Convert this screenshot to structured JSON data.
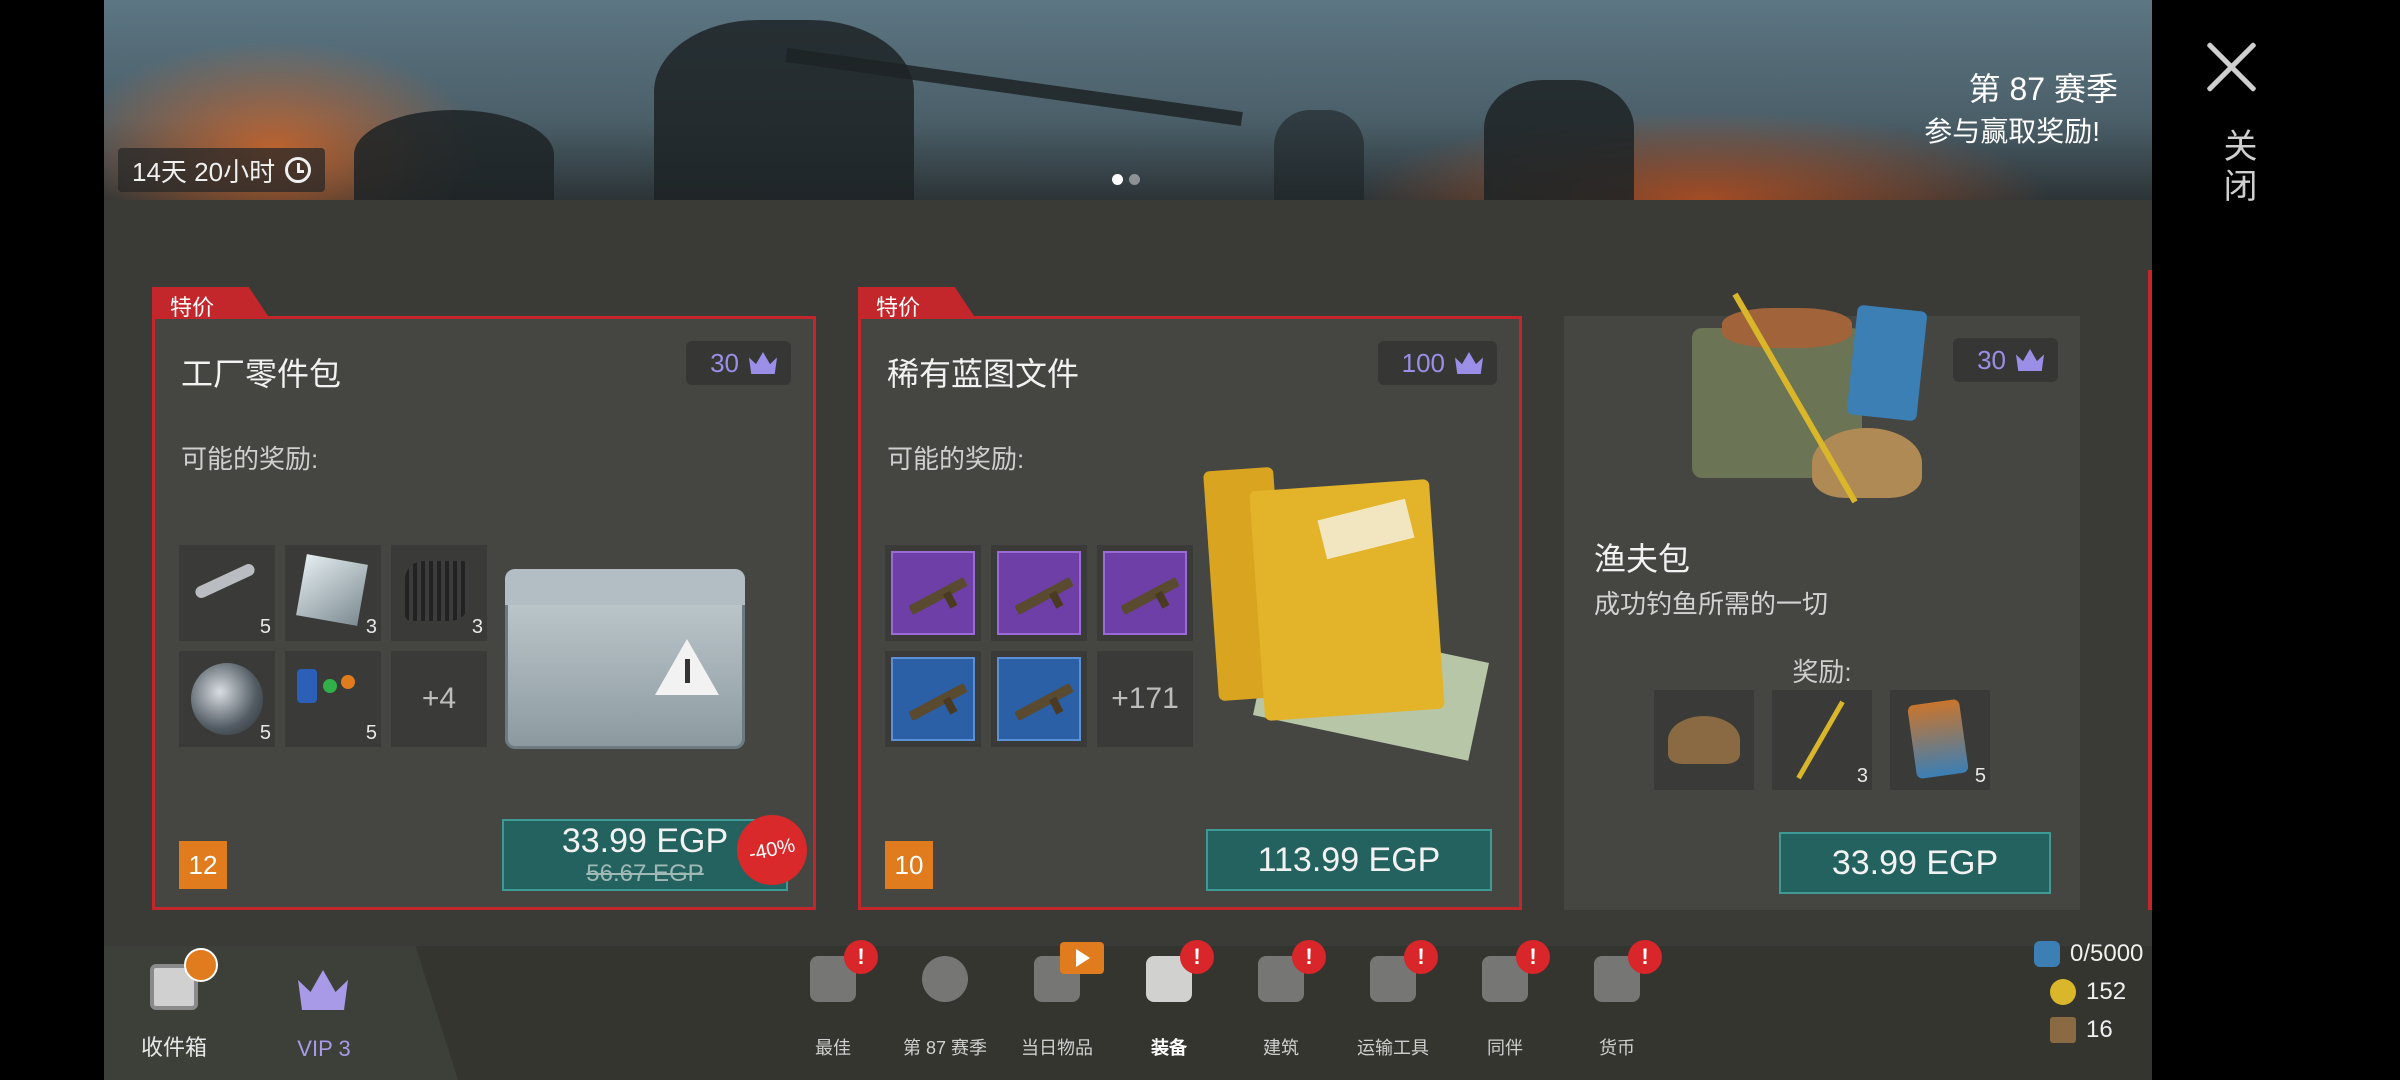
{
  "banner": {
    "timer": "14天 20小时",
    "season_title": "第 87 赛季",
    "season_subtitle": "参与赢取奖励!",
    "page_dots": 2
  },
  "close": {
    "label": "关闭"
  },
  "offers": [
    {
      "badge": "特价",
      "title": "工厂零件包",
      "crowns": "30",
      "rewards_label": "可能的奖励:",
      "items": [
        {
          "icon": "pipe-parts-icon",
          "qty": "5"
        },
        {
          "icon": "metal-plate-icon",
          "qty": "3"
        },
        {
          "icon": "rubber-sheet-icon",
          "qty": "3"
        },
        {
          "icon": "lens-icon",
          "qty": "5"
        },
        {
          "icon": "electronic-components-icon",
          "qty": "5"
        }
      ],
      "more": "+4",
      "stock": "12",
      "price": "33.99 EGP",
      "old_price": "56.67 EGP",
      "discount": "-40%"
    },
    {
      "badge": "特价",
      "title": "稀有蓝图文件",
      "crowns": "100",
      "rewards_label": "可能的奖励:",
      "items": [
        {
          "icon": "purple-weapon-blueprint-icon"
        },
        {
          "icon": "purple-weapon-blueprint-icon"
        },
        {
          "icon": "purple-weapon-blueprint-icon"
        },
        {
          "icon": "blue-weapon-blueprint-icon"
        },
        {
          "icon": "blue-weapon-blueprint-icon"
        }
      ],
      "more": "+171",
      "stock": "10",
      "price": "113.99 EGP"
    },
    {
      "title": "渔夫包",
      "crowns": "30",
      "description": "成功钓鱼所需的一切",
      "rewards_label": "奖励:",
      "items": [
        {
          "icon": "fishing-hat-icon",
          "qty": ""
        },
        {
          "icon": "fishing-rod-icon",
          "qty": "3"
        },
        {
          "icon": "bait-bag-icon",
          "qty": "5"
        }
      ],
      "price": "33.99 EGP"
    }
  ],
  "bottom_left": [
    {
      "label": "收件箱",
      "icon": "safe-icon"
    },
    {
      "label": "VIP 3",
      "icon": "crown-icon"
    }
  ],
  "nav": [
    {
      "label": "最佳",
      "icon": "thumbs-up-icon",
      "alert": "!"
    },
    {
      "label": "第 87 赛季",
      "icon": "season-badge-icon",
      "alert": ""
    },
    {
      "label": "当日物品",
      "icon": "fire-icon",
      "video": true
    },
    {
      "label": "装备",
      "icon": "pistol-icon",
      "alert": "!",
      "active": true
    },
    {
      "label": "建筑",
      "icon": "tools-icon",
      "alert": "!"
    },
    {
      "label": "运输工具",
      "icon": "motorcycle-icon",
      "alert": "!"
    },
    {
      "label": "同伴",
      "icon": "dog-icon",
      "alert": "!"
    },
    {
      "label": "货币",
      "icon": "wallet-icon",
      "alert": "!"
    }
  ],
  "currencies": [
    {
      "icon": "energy-drink-icon",
      "value": "0/5000"
    },
    {
      "icon": "coin-icon",
      "value": "152"
    },
    {
      "icon": "crate-icon",
      "value": "16"
    }
  ]
}
